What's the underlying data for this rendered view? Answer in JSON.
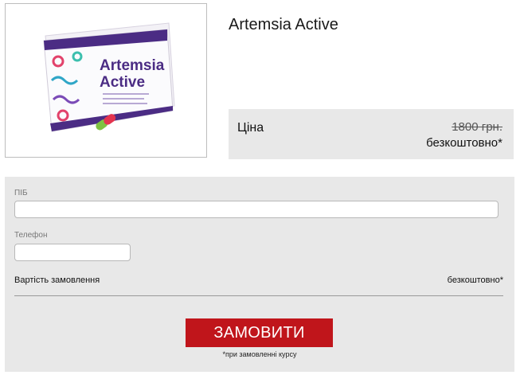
{
  "product": {
    "title": "Artemsia Active",
    "image_alt": "Artemsia Active package",
    "box_brand_line1": "Artemsia",
    "box_brand_line2": "Active"
  },
  "price": {
    "label": "Ціна",
    "old_price": "1800 грн.",
    "new_price": "безкоштовно*"
  },
  "form": {
    "name_label": "ПІБ",
    "name_value": "",
    "phone_label": "Телефон",
    "phone_value": "",
    "cost_label": "Вартість замовлення",
    "cost_value": "безкоштовно*",
    "submit_label": "ЗАМОВИТИ",
    "note": "*при замовленні курсу"
  },
  "colors": {
    "button": "#c0151b",
    "panel": "#e8e8e8",
    "brand_purple": "#4b2c84"
  }
}
